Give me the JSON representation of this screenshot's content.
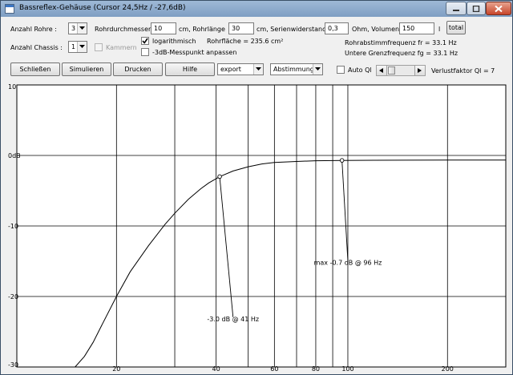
{
  "window": {
    "title": "Bassreflex-Gehäuse (Cursor 24,5Hz / -27,6dB)",
    "app_icon": "app-window-icon",
    "controls": [
      "minimize-icon",
      "maximize-icon",
      "close-icon"
    ],
    "colors": {
      "titlebar": "#8aa8c9",
      "close_button": "#c7452a",
      "background": "#f0f0f0"
    }
  },
  "form": {
    "anzahl_rohre_label": "Anzahl Rohre :",
    "anzahl_rohre_value": "3",
    "rohrdurchmesser_label": "Rohrdurchmesser",
    "rohrdurchmesser_value": "10",
    "rohrlaenge_label": "cm, Rohrlänge",
    "rohrlaenge_value": "30",
    "serienwiderstand_label": "cm, Serienwiderstand",
    "serienwiderstand_value": "0,3",
    "volumen_label": "Ohm, Volumen",
    "volumen_value": "150",
    "volumen_unit": "l",
    "total_button": "total",
    "anzahl_chassis_label": "Anzahl Chassis :",
    "anzahl_chassis_value": "1",
    "kammern_label": "Kammern",
    "kammern_checked": false,
    "logarithmisch_label": "logarithmisch",
    "logarithmisch_checked": true,
    "messpunkt_label": "-3dB-Messpunkt anpassen",
    "messpunkt_checked": false,
    "rohrflaeche": "Rohrfläche = 235.6 cm²",
    "rohrabstimmfrequenz": "Rohrabstimmfrequenz fr = 33.1 Hz",
    "untere_grenzfrequenz": "Untere Grenzfrequenz fg = 33.1 Hz"
  },
  "toolbar": {
    "schliessen": "Schließen",
    "simulieren": "Simulieren",
    "drucken": "Drucken",
    "hilfe": "Hilfe",
    "export_value": "export",
    "abstimmung_value": "Abstimmung",
    "auto_ql_label": "Auto Ql",
    "auto_ql_checked": false,
    "verlustfaktor": "Verlustfaktor Ql = 7"
  },
  "chart_data": {
    "type": "line",
    "title": "",
    "xlabel": "",
    "ylabel": "",
    "x_scale": "log",
    "xlim": [
      10,
      300
    ],
    "ylim": [
      -30,
      10
    ],
    "y_ticks": [
      {
        "value": 10,
        "label": "10"
      },
      {
        "value": 0,
        "label": "0dB"
      },
      {
        "value": -10,
        "label": "-10"
      },
      {
        "value": -20,
        "label": "-20"
      },
      {
        "value": -30,
        "label": "-30"
      }
    ],
    "x_gridlines": [
      20,
      30,
      40,
      50,
      60,
      70,
      80,
      90,
      100,
      200
    ],
    "x_tick_labels": [
      {
        "value": 20,
        "label": "20"
      },
      {
        "value": 40,
        "label": "40"
      },
      {
        "value": 60,
        "label": "60"
      },
      {
        "value": 80,
        "label": "80"
      },
      {
        "value": 100,
        "label": "100"
      },
      {
        "value": 200,
        "label": "200"
      }
    ],
    "grid": true,
    "series": [
      {
        "x": [
          10,
          15,
          16,
          17,
          18,
          20,
          22,
          25,
          28,
          30,
          33,
          36,
          38,
          41,
          45,
          50,
          55,
          60,
          70,
          80,
          96,
          120,
          150,
          200,
          300
        ],
        "y": [
          -30,
          -30,
          -28.5,
          -26.5,
          -24.2,
          -20,
          -16.5,
          -12.8,
          -9.8,
          -8.2,
          -6.2,
          -4.7,
          -3.9,
          -3.0,
          -2.2,
          -1.6,
          -1.2,
          -1.0,
          -0.85,
          -0.75,
          -0.7,
          -0.68,
          -0.67,
          -0.66,
          -0.65
        ]
      }
    ],
    "annotations": [
      {
        "text": "-3.0 dB @  41 Hz",
        "point": {
          "x": 41,
          "y": -3.0
        },
        "label_at": {
          "x": 45,
          "y": -23.5
        }
      },
      {
        "text": "max -0.7 dB @ 96 Hz",
        "point": {
          "x": 96,
          "y": -0.7
        },
        "label_at": {
          "x": 100,
          "y": -15.5
        }
      }
    ]
  }
}
